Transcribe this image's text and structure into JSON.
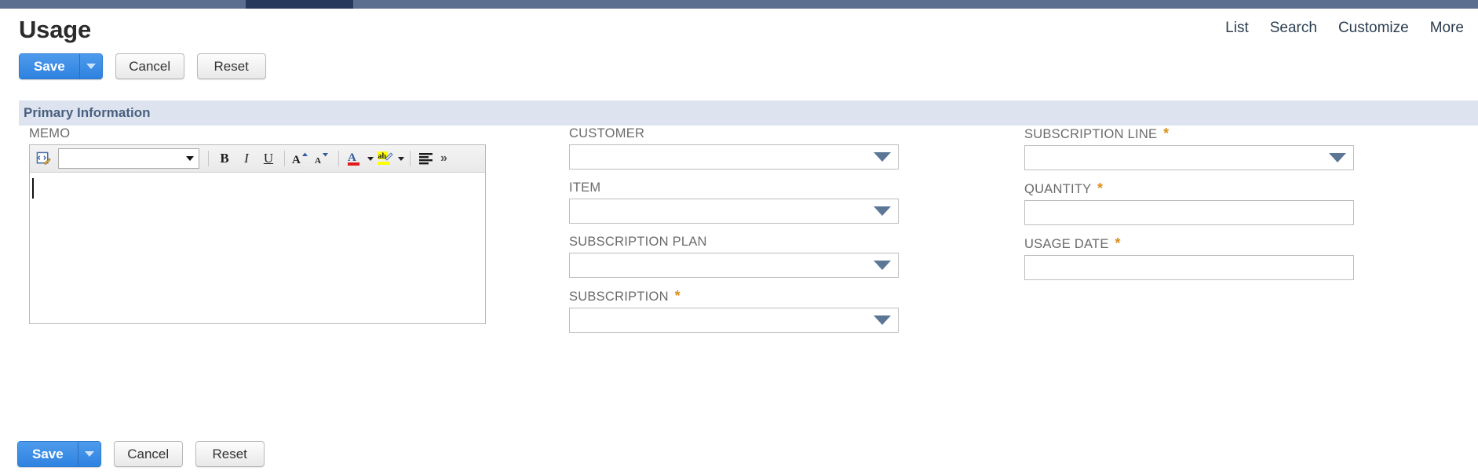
{
  "window": {
    "chrome_bar_color": "#5b6e8f",
    "active_tab_color": "#26395c"
  },
  "header": {
    "title": "Usage",
    "links": [
      {
        "label": "List",
        "name": "list"
      },
      {
        "label": "Search",
        "name": "search"
      },
      {
        "label": "Customize",
        "name": "customize"
      },
      {
        "label": "More",
        "name": "more"
      }
    ]
  },
  "actions": {
    "save_label": "Save",
    "save_dropdown_icon": "caret-down-icon",
    "cancel_label": "Cancel",
    "reset_label": "Reset"
  },
  "section": {
    "title": "Primary Information",
    "background_color": "#dde4ef",
    "text_color": "#4a5f80"
  },
  "memo": {
    "label": "MEMO",
    "value": "",
    "toolbar": {
      "source_icon": "html-source-edit-icon",
      "style_select_value": "",
      "buttons": [
        {
          "name": "bold-button",
          "glyph": "B",
          "class": "bold"
        },
        {
          "name": "italic-button",
          "glyph": "I",
          "class": "ital"
        },
        {
          "name": "underline-button",
          "glyph": "U",
          "class": "undr"
        }
      ],
      "grow_font_icon": "grow-font-icon",
      "shrink_font_icon": "shrink-font-icon",
      "text_color_icon": "text-color-icon",
      "highlight_color_icon": "highlight-color-icon",
      "align_icon": "align-justify-icon",
      "overflow_icon": "double-chevron-right-icon",
      "text_color_swatch": "#e01b1b",
      "highlight_color_swatch": "#ffff00"
    }
  },
  "fields": {
    "middle": [
      {
        "name": "customer",
        "label": "CUSTOMER",
        "required": false,
        "type": "select",
        "value": ""
      },
      {
        "name": "item",
        "label": "ITEM",
        "required": false,
        "type": "select",
        "value": ""
      },
      {
        "name": "subscription-plan",
        "label": "SUBSCRIPTION PLAN",
        "required": false,
        "type": "select",
        "value": ""
      },
      {
        "name": "subscription",
        "label": "SUBSCRIPTION",
        "required": true,
        "type": "select",
        "value": ""
      }
    ],
    "right": [
      {
        "name": "subscription-line",
        "label": "SUBSCRIPTION LINE",
        "required": true,
        "type": "select",
        "value": ""
      },
      {
        "name": "quantity",
        "label": "QUANTITY",
        "required": true,
        "type": "text",
        "value": ""
      },
      {
        "name": "usage-date",
        "label": "USAGE DATE",
        "required": true,
        "type": "text",
        "value": ""
      }
    ],
    "required_marker": "*",
    "required_marker_color": "#d99017"
  }
}
